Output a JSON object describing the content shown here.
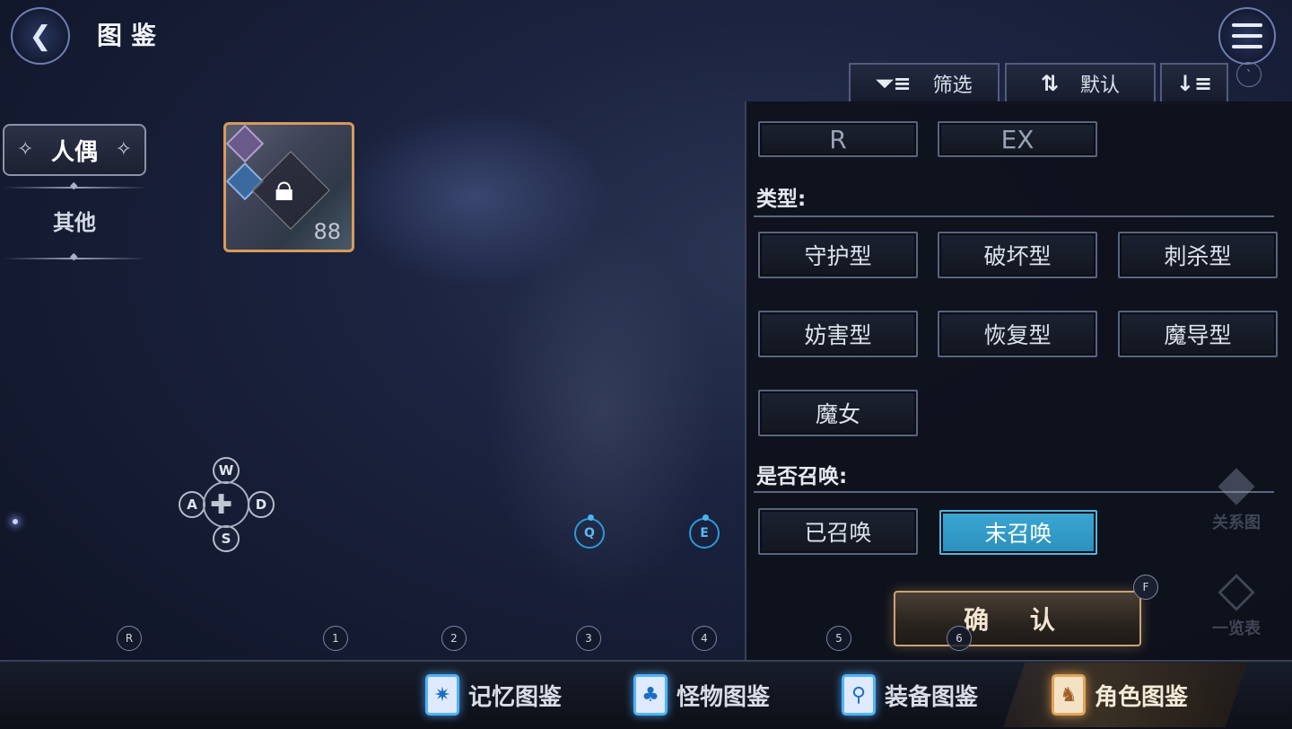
{
  "header": {
    "title": "图鉴"
  },
  "toolbar": {
    "filter_label": "筛选",
    "sort_label": "默认"
  },
  "small_key": "`",
  "categories": {
    "active": "人偶",
    "other": "其他"
  },
  "card": {
    "level": "88"
  },
  "keys": {
    "w": "W",
    "a": "A",
    "s": "S",
    "d": "D",
    "q": "Q",
    "e": "E",
    "r": "R",
    "f": "F",
    "nums": [
      "1",
      "2",
      "3",
      "4",
      "5",
      "6"
    ]
  },
  "filter": {
    "rarity_top": [
      "R",
      "EX"
    ],
    "type_heading": "类型:",
    "types": [
      "守护型",
      "破坏型",
      "刺杀型",
      "妨害型",
      "恢复型",
      "魔导型",
      "魔女"
    ],
    "summon_heading": "是否召唤:",
    "summon": [
      "已召唤",
      "末召唤"
    ],
    "summon_selected": "末召唤",
    "confirm": "确  认"
  },
  "side_icons": {
    "relation": "关系图",
    "overview": "一览表"
  },
  "bottom_tabs": [
    {
      "label": "记忆图鉴",
      "icon": "memory-icon"
    },
    {
      "label": "怪物图鉴",
      "icon": "monster-icon"
    },
    {
      "label": "装备图鉴",
      "icon": "equipment-icon"
    },
    {
      "label": "角色图鉴",
      "icon": "character-icon",
      "active": true
    }
  ],
  "colors": {
    "selected": "#3aa7d4",
    "confirm_border": "#c9a374",
    "card_border": "#d89a5a",
    "tab_glow": "#4fb3ff"
  }
}
